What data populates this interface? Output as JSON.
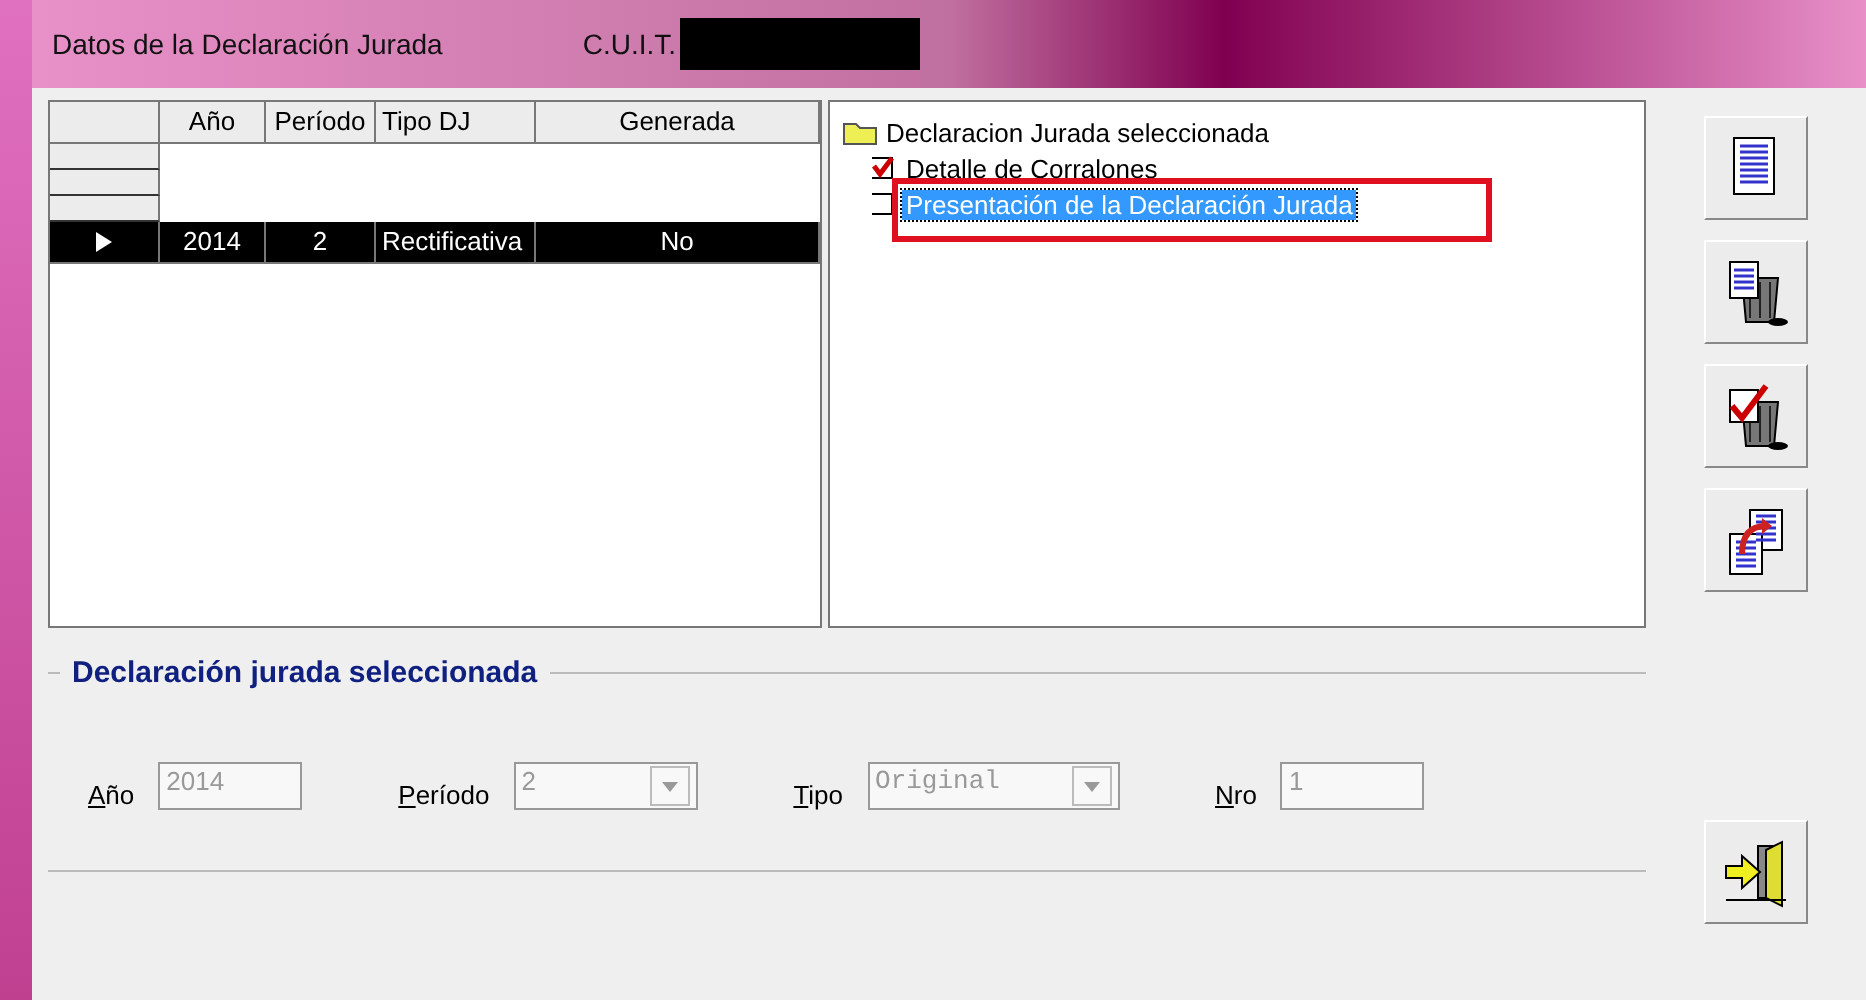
{
  "window": {
    "title": "Datos de la Declaración Jurada",
    "cuit_label": "C.U.I.T.",
    "cuit_redacted": true
  },
  "grid": {
    "columns": [
      "Año",
      "Período",
      "Tipo DJ",
      "Generada"
    ],
    "rows": [
      {
        "cells": [
          "2014",
          "2",
          "Rectificativa",
          "No"
        ],
        "selected": true
      }
    ]
  },
  "tree": {
    "root": {
      "label": "Declaracion Jurada seleccionada",
      "children": [
        {
          "label": "Detalle de Corralones",
          "checked": true,
          "selected": false,
          "highlighted": false
        },
        {
          "label": "Presentación de la Declaración Jurada",
          "checked": false,
          "selected": true,
          "highlighted": true
        }
      ]
    }
  },
  "toolbar": [
    {
      "kind": "document"
    },
    {
      "kind": "delete"
    },
    {
      "kind": "check-delete"
    },
    {
      "kind": "copy"
    },
    {
      "kind": "exit"
    }
  ],
  "group": {
    "title": "Declaración jurada seleccionada",
    "fields": [
      {
        "label": "Año",
        "value": "2014",
        "kind": "text",
        "disabled": true
      },
      {
        "label": "Período",
        "value": "2",
        "kind": "combo",
        "disabled": true
      },
      {
        "label": "Tipo",
        "value": "Original",
        "kind": "combo",
        "disabled": true,
        "mono": true
      },
      {
        "label": "Nro",
        "value": "1",
        "kind": "text",
        "disabled": true
      }
    ]
  }
}
